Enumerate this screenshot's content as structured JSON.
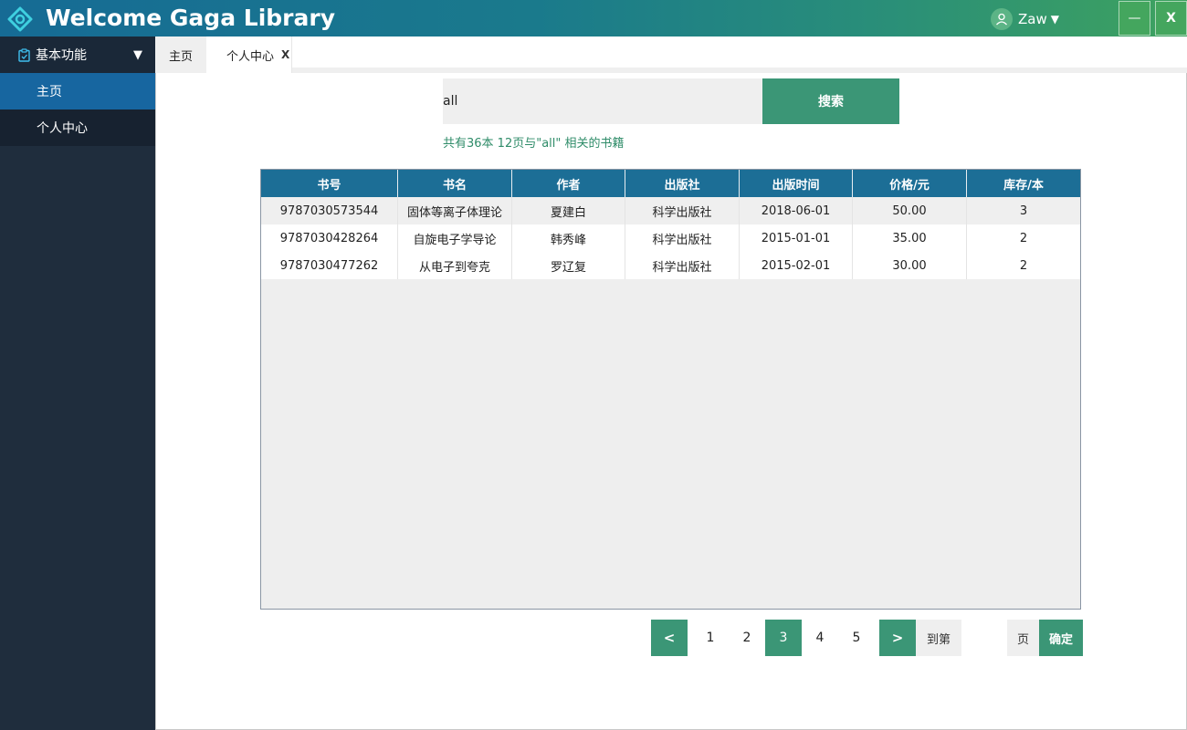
{
  "app": {
    "title": "Welcome Gaga Library",
    "user": "Zaw",
    "minimize_label": "—",
    "close_label": "X"
  },
  "sidebar": {
    "group_label": "基本功能",
    "items": [
      {
        "label": "主页",
        "active": true
      },
      {
        "label": "个人中心",
        "active": false
      }
    ]
  },
  "tabs": {
    "home": "主页",
    "user_center": "个人中心",
    "close_label": "X"
  },
  "search": {
    "value": "all",
    "button_label": "搜索",
    "summary": "共有36本 12页与\"all\" 相关的书籍"
  },
  "table": {
    "headers": [
      "书号",
      "书名",
      "作者",
      "出版社",
      "出版时间",
      "价格/元",
      "库存/本"
    ],
    "rows": [
      [
        "9787030573544",
        "固体等离子体理论",
        "夏建白",
        "科学出版社",
        "2018-06-01",
        "50.00",
        "3"
      ],
      [
        "9787030428264",
        "自旋电子学导论",
        "韩秀峰",
        "科学出版社",
        "2015-01-01",
        "35.00",
        "2"
      ],
      [
        "9787030477262",
        "从电子到夸克",
        "罗辽复",
        "科学出版社",
        "2015-02-01",
        "30.00",
        "2"
      ]
    ]
  },
  "pagination": {
    "prev": "<",
    "next": ">",
    "pages": [
      "1",
      "2",
      "3",
      "4",
      "5"
    ],
    "current": "3",
    "goto_label": "到第",
    "goto_value": "",
    "page_unit": "页",
    "confirm_label": "确定"
  },
  "colors": {
    "accent_green": "#3b9676",
    "header_blue": "#1c6e96",
    "sidebar_bg": "#1f2d3d",
    "sidebar_active": "#1766a0"
  }
}
